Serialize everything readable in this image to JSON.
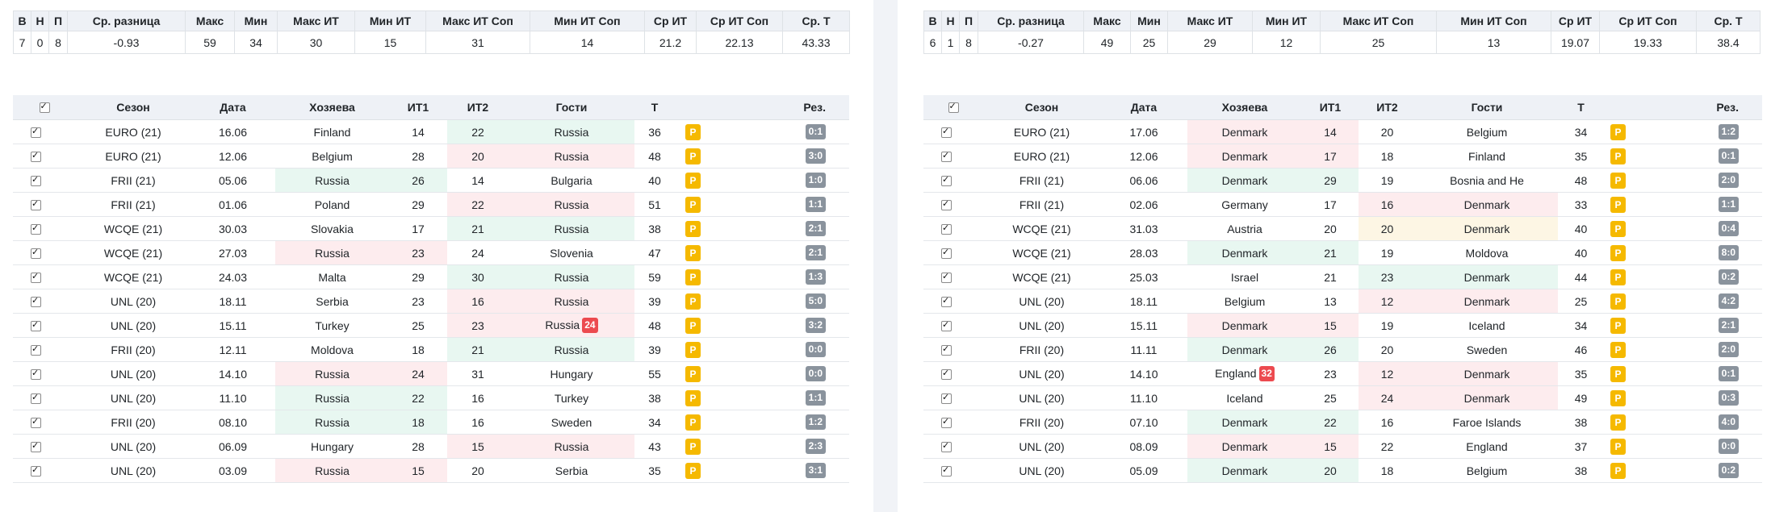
{
  "stats_headers": [
    "В",
    "Н",
    "П",
    "Ср. разница",
    "Макс",
    "Мин",
    "Макс ИТ",
    "Мин ИТ",
    "Макс ИТ Соп",
    "Мин ИТ Соп",
    "Ср ИТ",
    "Ср ИТ Соп",
    "Ср. Т"
  ],
  "match_headers": [
    "",
    "Сезон",
    "Дата",
    "Хозяева",
    "ИТ1",
    "ИТ2",
    "Гости",
    "Т",
    "",
    "Рез."
  ],
  "colors": {
    "win_bg": "#e8f7f1",
    "loss_bg": "#fdecee",
    "draw_bg": "#fdf6e4",
    "p_badge": "#f5b900",
    "result_badge": "#8a939d",
    "alert_badge": "#ec4a4f"
  },
  "panels": [
    {
      "stats": [
        "7",
        "0",
        "8",
        "-0.93",
        "59",
        "34",
        "30",
        "15",
        "31",
        "14",
        "21.2",
        "22.13",
        "43.33"
      ],
      "matches": [
        {
          "season": "EURO (21)",
          "date": "16.06",
          "home": "Finland",
          "it1": "14",
          "it2": "22",
          "away": "Russia",
          "total": "36",
          "badge": "P",
          "result": "0:1",
          "hl": "away-green",
          "alert": ""
        },
        {
          "season": "EURO (21)",
          "date": "12.06",
          "home": "Belgium",
          "it1": "28",
          "it2": "20",
          "away": "Russia",
          "total": "48",
          "badge": "P",
          "result": "3:0",
          "hl": "away-red",
          "alert": ""
        },
        {
          "season": "FRII (21)",
          "date": "05.06",
          "home": "Russia",
          "it1": "26",
          "it2": "14",
          "away": "Bulgaria",
          "total": "40",
          "badge": "P",
          "result": "1:0",
          "hl": "home-green",
          "alert": ""
        },
        {
          "season": "FRII (21)",
          "date": "01.06",
          "home": "Poland",
          "it1": "29",
          "it2": "22",
          "away": "Russia",
          "total": "51",
          "badge": "P",
          "result": "1:1",
          "hl": "away-red",
          "alert": ""
        },
        {
          "season": "WCQE (21)",
          "date": "30.03",
          "home": "Slovakia",
          "it1": "17",
          "it2": "21",
          "away": "Russia",
          "total": "38",
          "badge": "P",
          "result": "2:1",
          "hl": "away-green",
          "alert": ""
        },
        {
          "season": "WCQE (21)",
          "date": "27.03",
          "home": "Russia",
          "it1": "23",
          "it2": "24",
          "away": "Slovenia",
          "total": "47",
          "badge": "P",
          "result": "2:1",
          "hl": "home-red",
          "alert": ""
        },
        {
          "season": "WCQE (21)",
          "date": "24.03",
          "home": "Malta",
          "it1": "29",
          "it2": "30",
          "away": "Russia",
          "total": "59",
          "badge": "P",
          "result": "1:3",
          "hl": "away-green",
          "alert": ""
        },
        {
          "season": "UNL (20)",
          "date": "18.11",
          "home": "Serbia",
          "it1": "23",
          "it2": "16",
          "away": "Russia",
          "total": "39",
          "badge": "P",
          "result": "5:0",
          "hl": "away-red",
          "alert": ""
        },
        {
          "season": "UNL (20)",
          "date": "15.11",
          "home": "Turkey",
          "it1": "25",
          "it2": "23",
          "away": "Russia",
          "total": "48",
          "badge": "P",
          "result": "3:2",
          "hl": "away-red",
          "alert": "24"
        },
        {
          "season": "FRII (20)",
          "date": "12.11",
          "home": "Moldova",
          "it1": "18",
          "it2": "21",
          "away": "Russia",
          "total": "39",
          "badge": "P",
          "result": "0:0",
          "hl": "away-green",
          "alert": ""
        },
        {
          "season": "UNL (20)",
          "date": "14.10",
          "home": "Russia",
          "it1": "24",
          "it2": "31",
          "away": "Hungary",
          "total": "55",
          "badge": "P",
          "result": "0:0",
          "hl": "home-red",
          "alert": ""
        },
        {
          "season": "UNL (20)",
          "date": "11.10",
          "home": "Russia",
          "it1": "22",
          "it2": "16",
          "away": "Turkey",
          "total": "38",
          "badge": "P",
          "result": "1:1",
          "hl": "home-green",
          "alert": ""
        },
        {
          "season": "FRII (20)",
          "date": "08.10",
          "home": "Russia",
          "it1": "18",
          "it2": "16",
          "away": "Sweden",
          "total": "34",
          "badge": "P",
          "result": "1:2",
          "hl": "home-green",
          "alert": ""
        },
        {
          "season": "UNL (20)",
          "date": "06.09",
          "home": "Hungary",
          "it1": "28",
          "it2": "15",
          "away": "Russia",
          "total": "43",
          "badge": "P",
          "result": "2:3",
          "hl": "away-red",
          "alert": ""
        },
        {
          "season": "UNL (20)",
          "date": "03.09",
          "home": "Russia",
          "it1": "15",
          "it2": "20",
          "away": "Serbia",
          "total": "35",
          "badge": "P",
          "result": "3:1",
          "hl": "home-red",
          "alert": ""
        }
      ]
    },
    {
      "stats": [
        "6",
        "1",
        "8",
        "-0.27",
        "49",
        "25",
        "29",
        "12",
        "25",
        "13",
        "19.07",
        "19.33",
        "38.4"
      ],
      "matches": [
        {
          "season": "EURO (21)",
          "date": "17.06",
          "home": "Denmark",
          "it1": "14",
          "it2": "20",
          "away": "Belgium",
          "total": "34",
          "badge": "P",
          "result": "1:2",
          "hl": "home-red",
          "alert": ""
        },
        {
          "season": "EURO (21)",
          "date": "12.06",
          "home": "Denmark",
          "it1": "17",
          "it2": "18",
          "away": "Finland",
          "total": "35",
          "badge": "P",
          "result": "0:1",
          "hl": "home-red",
          "alert": ""
        },
        {
          "season": "FRII (21)",
          "date": "06.06",
          "home": "Denmark",
          "it1": "29",
          "it2": "19",
          "away": "Bosnia and He",
          "total": "48",
          "badge": "P",
          "result": "2:0",
          "hl": "home-green",
          "alert": ""
        },
        {
          "season": "FRII (21)",
          "date": "02.06",
          "home": "Germany",
          "it1": "17",
          "it2": "16",
          "away": "Denmark",
          "total": "33",
          "badge": "P",
          "result": "1:1",
          "hl": "away-red",
          "alert": ""
        },
        {
          "season": "WCQE (21)",
          "date": "31.03",
          "home": "Austria",
          "it1": "20",
          "it2": "20",
          "away": "Denmark",
          "total": "40",
          "badge": "P",
          "result": "0:4",
          "hl": "away-yellow",
          "alert": ""
        },
        {
          "season": "WCQE (21)",
          "date": "28.03",
          "home": "Denmark",
          "it1": "21",
          "it2": "19",
          "away": "Moldova",
          "total": "40",
          "badge": "P",
          "result": "8:0",
          "hl": "home-green",
          "alert": ""
        },
        {
          "season": "WCQE (21)",
          "date": "25.03",
          "home": "Israel",
          "it1": "21",
          "it2": "23",
          "away": "Denmark",
          "total": "44",
          "badge": "P",
          "result": "0:2",
          "hl": "away-green",
          "alert": ""
        },
        {
          "season": "UNL (20)",
          "date": "18.11",
          "home": "Belgium",
          "it1": "13",
          "it2": "12",
          "away": "Denmark",
          "total": "25",
          "badge": "P",
          "result": "4:2",
          "hl": "away-red",
          "alert": ""
        },
        {
          "season": "UNL (20)",
          "date": "15.11",
          "home": "Denmark",
          "it1": "15",
          "it2": "19",
          "away": "Iceland",
          "total": "34",
          "badge": "P",
          "result": "2:1",
          "hl": "home-red",
          "alert": ""
        },
        {
          "season": "FRII (20)",
          "date": "11.11",
          "home": "Denmark",
          "it1": "26",
          "it2": "20",
          "away": "Sweden",
          "total": "46",
          "badge": "P",
          "result": "2:0",
          "hl": "home-green",
          "alert": ""
        },
        {
          "season": "UNL (20)",
          "date": "14.10",
          "home": "England",
          "it1": "23",
          "it2": "12",
          "away": "Denmark",
          "total": "35",
          "badge": "P",
          "result": "0:1",
          "hl": "away-red",
          "alert": "32"
        },
        {
          "season": "UNL (20)",
          "date": "11.10",
          "home": "Iceland",
          "it1": "25",
          "it2": "24",
          "away": "Denmark",
          "total": "49",
          "badge": "P",
          "result": "0:3",
          "hl": "away-red",
          "alert": ""
        },
        {
          "season": "FRII (20)",
          "date": "07.10",
          "home": "Denmark",
          "it1": "22",
          "it2": "16",
          "away": "Faroe Islands",
          "total": "38",
          "badge": "P",
          "result": "4:0",
          "hl": "home-green",
          "alert": ""
        },
        {
          "season": "UNL (20)",
          "date": "08.09",
          "home": "Denmark",
          "it1": "15",
          "it2": "22",
          "away": "England",
          "total": "37",
          "badge": "P",
          "result": "0:0",
          "hl": "home-red",
          "alert": ""
        },
        {
          "season": "UNL (20)",
          "date": "05.09",
          "home": "Denmark",
          "it1": "20",
          "it2": "18",
          "away": "Belgium",
          "total": "38",
          "badge": "P",
          "result": "0:2",
          "hl": "home-green",
          "alert": ""
        }
      ]
    }
  ]
}
